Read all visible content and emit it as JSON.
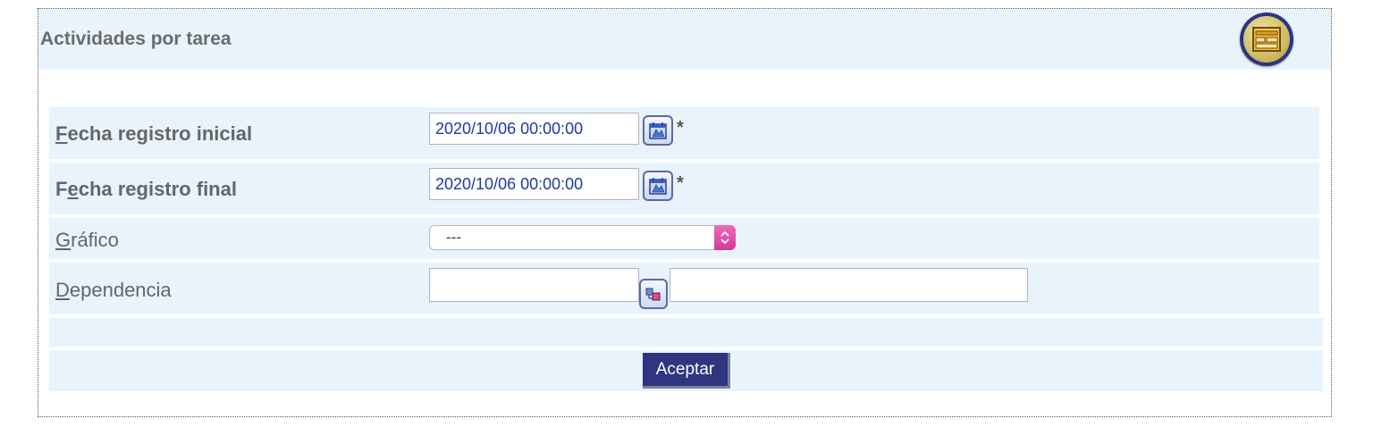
{
  "panel": {
    "title": "Actividades por tarea",
    "header_icon": "report-icon"
  },
  "form": {
    "fecha_inicial": {
      "label_first": "F",
      "label_rest": "echa registro inicial",
      "value": "2020/10/06 00:00:00",
      "required_mark": "*",
      "button_icon": "calendar-icon"
    },
    "fecha_final": {
      "label_first": "F",
      "label_second": "e",
      "label_rest": "cha registro final",
      "value": "2020/10/06 00:00:00",
      "required_mark": "*",
      "button_icon": "calendar-icon"
    },
    "grafico": {
      "label_first": "G",
      "label_rest": "ráfico",
      "selected": "---"
    },
    "dependencia": {
      "label_first": "D",
      "label_rest": "ependencia",
      "code_value": "",
      "name_value": "",
      "button_icon": "search-icon"
    }
  },
  "actions": {
    "accept_label": "Aceptar"
  },
  "colors": {
    "row_bg": "#e8f3fc",
    "button_bg": "#2f3580",
    "select_accent": "#d4399b"
  }
}
